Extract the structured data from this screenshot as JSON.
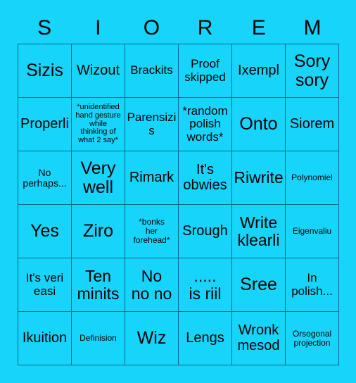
{
  "card": {
    "background_color": "#17d4fb",
    "border_color": "#0a6a86",
    "text_color": "#000000",
    "header": {
      "letters": [
        "S",
        "I",
        "O",
        "R",
        "E",
        "M"
      ]
    },
    "grid": {
      "columns": 6,
      "rows": 6,
      "cells": [
        {
          "text": "Sizis",
          "size": "xxl"
        },
        {
          "text": "Wizout",
          "size": "l"
        },
        {
          "text": "Brackits",
          "size": "m"
        },
        {
          "text": "Proof\nskipped",
          "size": "m"
        },
        {
          "text": "Ixempl",
          "size": "l"
        },
        {
          "text": "Sory\nsory",
          "size": "xxl"
        },
        {
          "text": "Properli",
          "size": "l"
        },
        {
          "text": "*unidentified\nhand gesture\nwhile\nthinking of\nwhat 2 say*",
          "size": "xxs"
        },
        {
          "text": "Parensizis",
          "size": "m"
        },
        {
          "text": "*random\npolish\nwords*",
          "size": "m"
        },
        {
          "text": "Onto",
          "size": "xxl"
        },
        {
          "text": "Siorem",
          "size": "l"
        },
        {
          "text": "No\nperhaps...",
          "size": "s"
        },
        {
          "text": "Very\nwell",
          "size": "xxl"
        },
        {
          "text": "Rimark",
          "size": "l"
        },
        {
          "text": "It's\nobwies",
          "size": "l"
        },
        {
          "text": "Riwrite",
          "size": "xl"
        },
        {
          "text": "Polynomiel",
          "size": "xs"
        },
        {
          "text": "Yes",
          "size": "xxl"
        },
        {
          "text": "Ziro",
          "size": "xxl"
        },
        {
          "text": "*bonks\nher\nforehead*",
          "size": "xs"
        },
        {
          "text": "Srough",
          "size": "l"
        },
        {
          "text": "Write\nklearli",
          "size": "xl"
        },
        {
          "text": "Eigenvaliu",
          "size": "xs"
        },
        {
          "text": "It's veri\neasi",
          "size": "m"
        },
        {
          "text": "Ten\nminits",
          "size": "xl"
        },
        {
          "text": "No\nno no",
          "size": "xl"
        },
        {
          "text": ".....\nis riil",
          "size": "xl"
        },
        {
          "text": "Sree",
          "size": "xxl"
        },
        {
          "text": "In\npolish...",
          "size": "m"
        },
        {
          "text": "Ikuition",
          "size": "l"
        },
        {
          "text": "Definision",
          "size": "xs"
        },
        {
          "text": "Wiz",
          "size": "xxl"
        },
        {
          "text": "Lengs",
          "size": "l"
        },
        {
          "text": "Wronk\nmesod",
          "size": "l"
        },
        {
          "text": "Orsogonal\nprojection",
          "size": "xs"
        }
      ]
    }
  }
}
